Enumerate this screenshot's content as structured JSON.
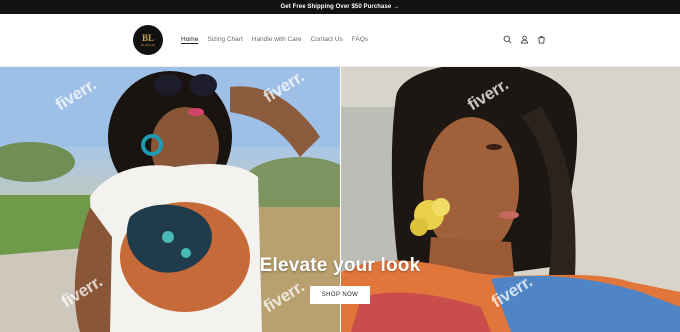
{
  "announcement": {
    "text": "Get Free Shipping Over $50 Purchase",
    "arrow": "→"
  },
  "logo": {
    "monogram": "BL",
    "brand_text": "BLAKCHI"
  },
  "nav": {
    "items": [
      {
        "label": "Home",
        "active": true
      },
      {
        "label": "Sizing Chart"
      },
      {
        "label": "Handle with Care"
      },
      {
        "label": "Contact Us"
      },
      {
        "label": "FAQs"
      }
    ]
  },
  "header_icons": [
    "search-icon",
    "account-icon",
    "cart-icon"
  ],
  "hero": {
    "title": "Elevate your look",
    "button_label": "SHOP NOW"
  },
  "watermark": {
    "text": "fiverr."
  },
  "colors": {
    "announcement_bg": "#121212",
    "nav_active": "#222222",
    "nav_text": "#6b6b6b"
  }
}
